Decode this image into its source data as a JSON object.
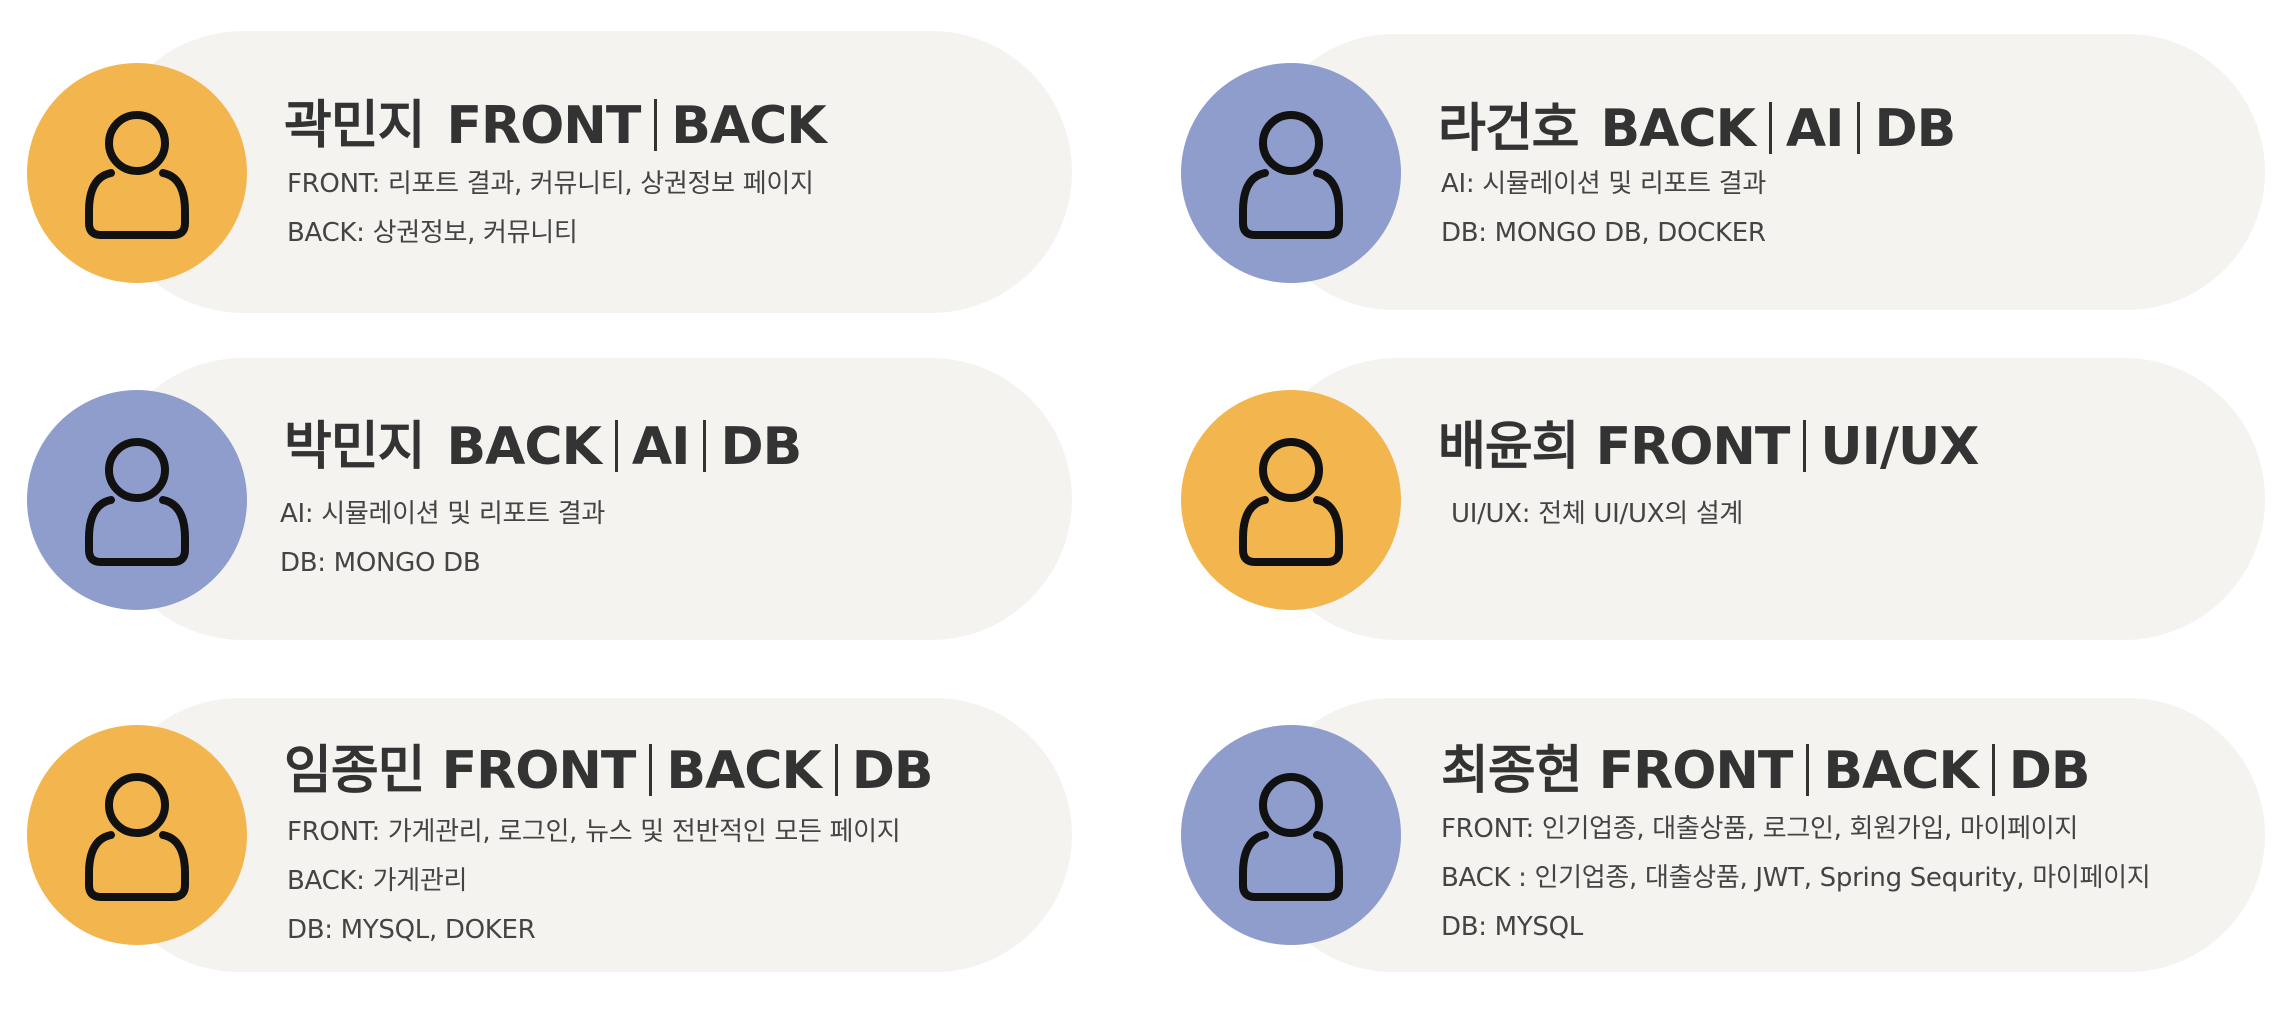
{
  "colors": {
    "orange": "#f3b64f",
    "purple": "#8e9dcc",
    "pill": "#f4f3f0",
    "text": "#333333"
  },
  "members": [
    {
      "name": "곽민지",
      "roles": [
        "FRONT",
        "BACK"
      ],
      "avatar_color": "#f3b64f",
      "avatar_icon": "user-icon",
      "lines": [
        "FRONT: 리포트 결과, 커뮤니티, 상권정보 페이지",
        "BACK: 상권정보, 커뮤니티"
      ]
    },
    {
      "name": "라건호",
      "roles": [
        "BACK",
        "AI",
        "DB"
      ],
      "avatar_color": "#8e9dcc",
      "avatar_icon": "user-icon",
      "lines": [
        "AI: 시뮬레이션 및 리포트 결과",
        "DB: MONGO DB, DOCKER"
      ]
    },
    {
      "name": "박민지",
      "roles": [
        "BACK",
        "AI",
        "DB"
      ],
      "avatar_color": "#8e9dcc",
      "avatar_icon": "user-icon",
      "lines": [
        "AI: 시뮬레이션 및 리포트 결과",
        "DB: MONGO DB"
      ]
    },
    {
      "name": "배윤희",
      "roles": [
        "FRONT",
        "UI/UX"
      ],
      "avatar_color": "#f3b64f",
      "avatar_icon": "user-icon",
      "lines": [
        "UI/UX: 전체 UI/UX의 설계"
      ]
    },
    {
      "name": "임종민",
      "roles": [
        "FRONT",
        "BACK",
        "DB"
      ],
      "avatar_color": "#f3b64f",
      "avatar_icon": "user-icon",
      "lines": [
        "FRONT: 가게관리, 로그인, 뉴스 및 전반적인 모든 페이지",
        "BACK: 가게관리",
        "DB: MYSQL, DOKER"
      ]
    },
    {
      "name": "최종현",
      "roles": [
        "FRONT",
        "BACK",
        "DB"
      ],
      "avatar_color": "#8e9dcc",
      "avatar_icon": "user-icon",
      "lines": [
        "FRONT:  인기업종, 대출상품, 로그인, 회원가입, 마이페이지",
        "BACK : 인기업종, 대출상품, JWT, Spring Sequrity, 마이페이지",
        "DB: MYSQL"
      ]
    }
  ]
}
